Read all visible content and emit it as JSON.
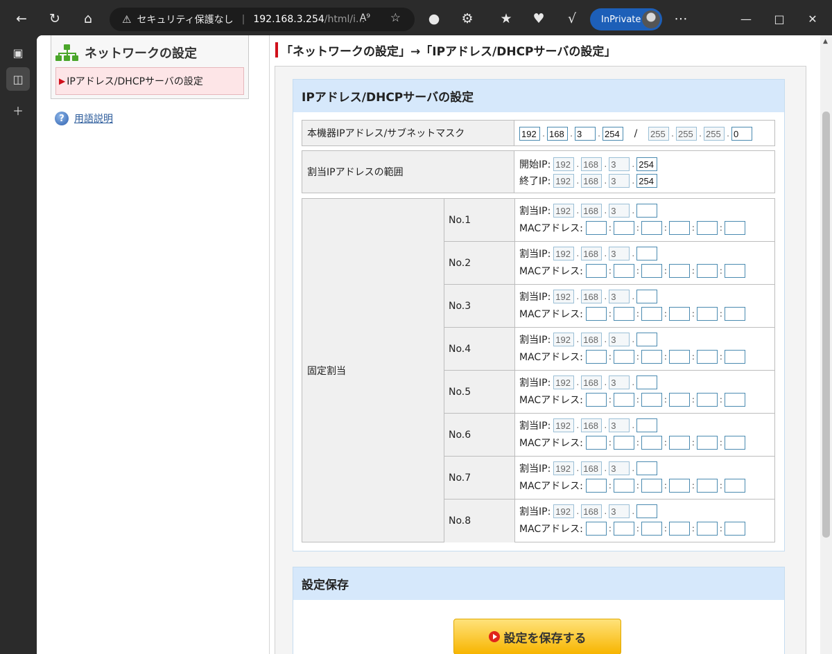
{
  "browser": {
    "security_text": "セキュリティ保護なし",
    "url_host": "192.168.3.254",
    "url_path": "/html/i...",
    "read_aloud": "A⁹",
    "inprivate_label": "InPrivate"
  },
  "menu": {
    "title": "ネットワークの設定",
    "items": [
      {
        "label": "IPアドレス/DHCPサーバの設定"
      }
    ],
    "help_link": "用語説明"
  },
  "breadcrumb": "「ネットワークの設定」→「IPアドレス/DHCPサーバの設定」",
  "ip_panel": {
    "title": "IPアドレス/DHCPサーバの設定",
    "device": {
      "label": "本機器IPアドレス/サブネットマスク",
      "ip": [
        "192",
        "168",
        "3",
        "254"
      ],
      "slash": "/",
      "mask": [
        "255",
        "255",
        "255",
        "0"
      ]
    },
    "range": {
      "label": "割当IPアドレスの範囲",
      "start_label": "開始IP:",
      "start": [
        "192",
        "168",
        "3",
        "254"
      ],
      "end_label": "終了IP:",
      "end": [
        "192",
        "168",
        "3",
        "254"
      ]
    },
    "fixed": {
      "label": "固定割当",
      "assign_label": "割当IP:",
      "mac_label": "MACアドレス:",
      "prefix": [
        "192",
        "168",
        "3"
      ],
      "rows": [
        {
          "no": "No.1",
          "last": ""
        },
        {
          "no": "No.2",
          "last": ""
        },
        {
          "no": "No.3",
          "last": ""
        },
        {
          "no": "No.4",
          "last": ""
        },
        {
          "no": "No.5",
          "last": ""
        },
        {
          "no": "No.6",
          "last": ""
        },
        {
          "no": "No.7",
          "last": ""
        },
        {
          "no": "No.8",
          "last": ""
        }
      ]
    }
  },
  "save_panel": {
    "title": "設定保存",
    "button": "設定を保存する"
  }
}
